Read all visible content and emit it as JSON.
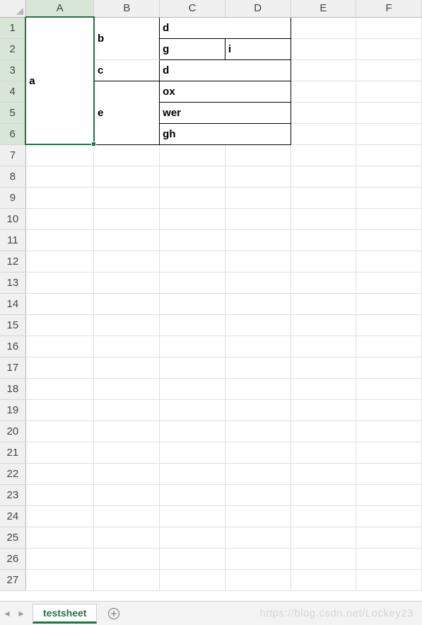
{
  "columns": [
    "A",
    "B",
    "C",
    "D",
    "E",
    "F"
  ],
  "visible_rows": 27,
  "selected_column": "A",
  "selected_rows": [
    1,
    2,
    3,
    4,
    5,
    6
  ],
  "cells": {
    "A": {
      "text": "a",
      "row": 1,
      "rowspan": 6,
      "borderBox": true
    },
    "B1": {
      "text": "b",
      "row": 1,
      "rowspan": 2,
      "borderBox": true
    },
    "B3": {
      "text": "c",
      "row": 3,
      "rowspan": 1,
      "borderBox": true
    },
    "B4": {
      "text": "e",
      "row": 4,
      "rowspan": 3,
      "borderBox": true
    },
    "C1": {
      "text": "d",
      "row": 1,
      "colspan": 2,
      "borderBox": true
    },
    "C2": {
      "text": "g",
      "row": 2,
      "borderBox": true
    },
    "D2": {
      "text": "i",
      "row": 2,
      "borderBox": true
    },
    "C3": {
      "text": "d",
      "row": 3,
      "colspan": 2,
      "borderBox": true
    },
    "C4": {
      "text": "ox",
      "row": 4,
      "colspan": 2,
      "borderBox": true
    },
    "C5": {
      "text": "wer",
      "row": 5,
      "colspan": 2,
      "borderBox": true
    },
    "C6": {
      "text": "gh",
      "row": 6,
      "colspan": 2,
      "borderBox": true
    }
  },
  "tabs": {
    "active": "testsheet"
  },
  "watermark": "https://blog.csdn.net/Lockey23"
}
